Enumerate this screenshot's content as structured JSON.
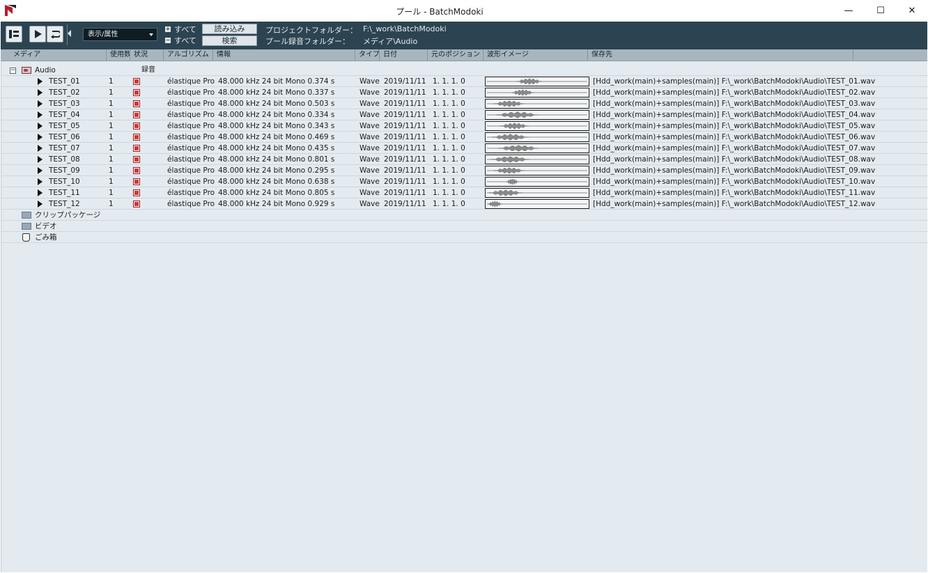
{
  "window": {
    "title": "プール - BatchModoki",
    "minimize_glyph": "—",
    "maximize_glyph": "☐",
    "close_glyph": "✕"
  },
  "toolbar": {
    "view_select_value": "表示/属性",
    "expand_all_label": "すべて",
    "collapse_all_label": "すべて",
    "load_button": "読み込み",
    "search_button": "検索",
    "project_folder_label": "プロジェクトフォルダー：",
    "project_folder_value": "F:\\_work\\BatchModoki",
    "record_folder_label": "プール録音フォルダー：",
    "record_folder_value": "メディア\\Audio"
  },
  "columns": [
    "メディア",
    "使用数",
    "状況",
    "アルゴリズム",
    "情報",
    "タイプ",
    "日付",
    "元のポジション",
    "波形イメージ",
    "保存先"
  ],
  "folders": {
    "audio": {
      "name": "Audio",
      "status": "録音"
    },
    "clip_packages": "クリップパッケージ",
    "video": "ビデオ",
    "trash": "ごみ箱"
  },
  "clips": [
    {
      "name": "TEST_01",
      "used": "1",
      "algorithm": "élastique Pro -",
      "info": "48.000 kHz  24 bit  Mono  0.374 s",
      "type": "Wave",
      "date": "2019/11/11",
      "origin": "1. 1. 1.  0",
      "path": "[Hdd_work(main)+samples(main)] F:\\_work\\BatchModoki\\Audio\\TEST_01.wav",
      "wave_start": 0.3,
      "wave_len": 0.25
    },
    {
      "name": "TEST_02",
      "used": "1",
      "algorithm": "élastique Pro -",
      "info": "48.000 kHz  24 bit  Mono  0.337 s",
      "type": "Wave",
      "date": "2019/11/11",
      "origin": "1. 1. 1.  0",
      "path": "[Hdd_work(main)+samples(main)] F:\\_work\\BatchModoki\\Audio\\TEST_02.wav",
      "wave_start": 0.25,
      "wave_len": 0.22
    },
    {
      "name": "TEST_03",
      "used": "1",
      "algorithm": "élastique Pro -",
      "info": "48.000 kHz  24 bit  Mono  0.503 s",
      "type": "Wave",
      "date": "2019/11/11",
      "origin": "1. 1. 1.  0",
      "path": "[Hdd_work(main)+samples(main)] F:\\_work\\BatchModoki\\Audio\\TEST_03.wav",
      "wave_start": 0.08,
      "wave_len": 0.3
    },
    {
      "name": "TEST_04",
      "used": "1",
      "algorithm": "élastique Pro -",
      "info": "48.000 kHz  24 bit  Mono  0.334 s",
      "type": "Wave",
      "date": "2019/11/11",
      "origin": "1. 1. 1.  0",
      "path": "[Hdd_work(main)+samples(main)] F:\\_work\\BatchModoki\\Audio\\TEST_04.wav",
      "wave_start": 0.1,
      "wave_len": 0.42
    },
    {
      "name": "TEST_05",
      "used": "1",
      "algorithm": "élastique Pro -",
      "info": "48.000 kHz  24 bit  Mono  0.343 s",
      "type": "Wave",
      "date": "2019/11/11",
      "origin": "1. 1. 1.  0",
      "path": "[Hdd_work(main)+samples(main)] F:\\_work\\BatchModoki\\Audio\\TEST_05.wav",
      "wave_start": 0.14,
      "wave_len": 0.28
    },
    {
      "name": "TEST_06",
      "used": "1",
      "algorithm": "élastique Pro -",
      "info": "48.000 kHz  24 bit  Mono  0.469 s",
      "type": "Wave",
      "date": "2019/11/11",
      "origin": "1. 1. 1.  0",
      "path": "[Hdd_work(main)+samples(main)] F:\\_work\\BatchModoki\\Audio\\TEST_06.wav",
      "wave_start": 0.06,
      "wave_len": 0.36
    },
    {
      "name": "TEST_07",
      "used": "1",
      "algorithm": "élastique Pro -",
      "info": "48.000 kHz  24 bit  Mono  0.435 s",
      "type": "Wave",
      "date": "2019/11/11",
      "origin": "1. 1. 1.  0",
      "path": "[Hdd_work(main)+samples(main)] F:\\_work\\BatchModoki\\Audio\\TEST_07.wav",
      "wave_start": 0.12,
      "wave_len": 0.4
    },
    {
      "name": "TEST_08",
      "used": "1",
      "algorithm": "élastique Pro -",
      "info": "48.000 kHz  24 bit  Mono  0.801 s",
      "type": "Wave",
      "date": "2019/11/11",
      "origin": "1. 1. 1.  0",
      "path": "[Hdd_work(main)+samples(main)] F:\\_work\\BatchModoki\\Audio\\TEST_08.wav",
      "wave_start": 0.05,
      "wave_len": 0.38
    },
    {
      "name": "TEST_09",
      "used": "1",
      "algorithm": "élastique Pro -",
      "info": "48.000 kHz  24 bit  Mono  0.295 s",
      "type": "Wave",
      "date": "2019/11/11",
      "origin": "1. 1. 1.  0",
      "path": "[Hdd_work(main)+samples(main)] F:\\_work\\BatchModoki\\Audio\\TEST_09.wav",
      "wave_start": 0.08,
      "wave_len": 0.3
    },
    {
      "name": "TEST_10",
      "used": "1",
      "algorithm": "élastique Pro -",
      "info": "48.000 kHz  24 bit  Mono  0.638 s",
      "type": "Wave",
      "date": "2019/11/11",
      "origin": "1. 1. 1.  0",
      "path": "[Hdd_work(main)+samples(main)] F:\\_work\\BatchModoki\\Audio\\TEST_10.wav",
      "wave_start": 0.2,
      "wave_len": 0.12
    },
    {
      "name": "TEST_11",
      "used": "1",
      "algorithm": "élastique Pro -",
      "info": "48.000 kHz  24 bit  Mono  0.805 s",
      "type": "Wave",
      "date": "2019/11/11",
      "origin": "1. 1. 1.  0",
      "path": "[Hdd_work(main)+samples(main)] F:\\_work\\BatchModoki\\Audio\\TEST_11.wav",
      "wave_start": 0.03,
      "wave_len": 0.33
    },
    {
      "name": "TEST_12",
      "used": "1",
      "algorithm": "élastique Pro -",
      "info": "48.000 kHz  24 bit  Mono  0.929 s",
      "type": "Wave",
      "date": "2019/11/11",
      "origin": "1. 1. 1.  0",
      "path": "[Hdd_work(main)+samples(main)] F:\\_work\\BatchModoki\\Audio\\TEST_12.wav",
      "wave_start": 0.02,
      "wave_len": 0.14
    }
  ],
  "icons": {
    "app": "cubase-logo-icon",
    "info_toggle": "inspector-icon",
    "play": "play-icon",
    "loop": "loop-icon",
    "folder": "folder-icon",
    "trash": "trash-icon",
    "status": "record-status-icon"
  },
  "colors": {
    "toolbar_bg": "#2c4451",
    "list_bg": "#e3eaf0",
    "header_bg": "#a8b6bf",
    "waveform": "#888888"
  }
}
